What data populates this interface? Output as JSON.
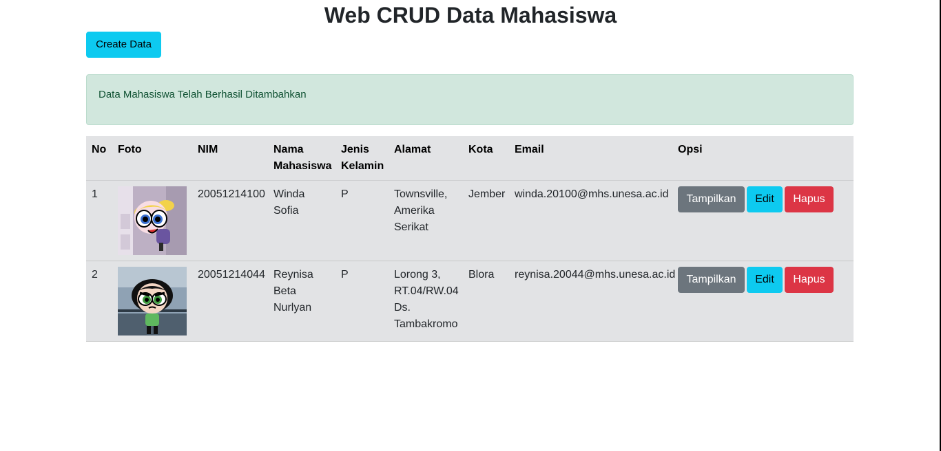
{
  "page": {
    "title": "Web CRUD Data Mahasiswa",
    "create_label": "Create Data",
    "alert_message": "Data Mahasiswa Telah Berhasil Ditambahkan"
  },
  "table": {
    "headers": [
      "No",
      "Foto",
      "NIM",
      "Nama Mahasiswa",
      "Jenis Kelamin",
      "Alamat",
      "Kota",
      "Email",
      "Opsi"
    ],
    "rows": [
      {
        "no": "1",
        "nim": "20051214100",
        "nama": "Winda Sofia",
        "jk": "P",
        "alamat": "Townsville, Amerika Serikat",
        "kota": "Jember",
        "email": "winda.20100@mhs.unesa.ac.id",
        "photo_icon": "bubbles-photo"
      },
      {
        "no": "2",
        "nim": "20051214044",
        "nama": "Reynisa Beta Nurlyan",
        "jk": "P",
        "alamat": "Lorong 3, RT.04/RW.04 Ds. Tambakromo",
        "kota": "Blora",
        "email": "reynisa.20044@mhs.unesa.ac.id",
        "photo_icon": "buttercup-photo"
      }
    ],
    "actions": {
      "show_label": "Tampilkan",
      "edit_label": "Edit",
      "delete_label": "Hapus"
    }
  },
  "colors": {
    "alert_bg": "#d1e7dd",
    "table_bg": "#e2e3e5",
    "info": "#0dcaf0",
    "secondary": "#6c757d",
    "danger": "#dc3545"
  }
}
